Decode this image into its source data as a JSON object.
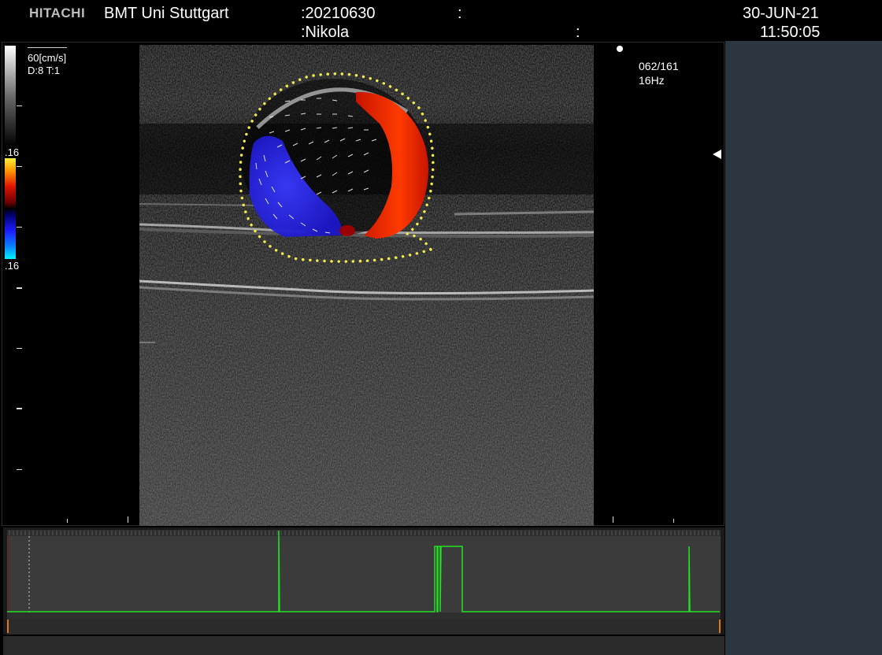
{
  "header": {
    "brand": "HITACHI",
    "institution": "BMT Uni Stuttgart",
    "patient_id": ":20210630",
    "patient_name": ":Nikola",
    "sep1": ":",
    "sep2": ":",
    "date": "30-JUN-21",
    "time": "11:50:05"
  },
  "scales": {
    "velocity_label": "60[cm/s]",
    "depth_label": "D:8 T:1",
    "color_top": ".16",
    "color_bottom": ".16"
  },
  "info": {
    "frame": "062/161",
    "frame_rate": "16Hz"
  },
  "colors": {
    "right_panel": "#2b3640",
    "trace": "#22e022",
    "dot_contour": "#f2e94a"
  },
  "icons": {
    "focus_marker": "triangle-left-icon",
    "probe_dot": "dot-icon"
  }
}
